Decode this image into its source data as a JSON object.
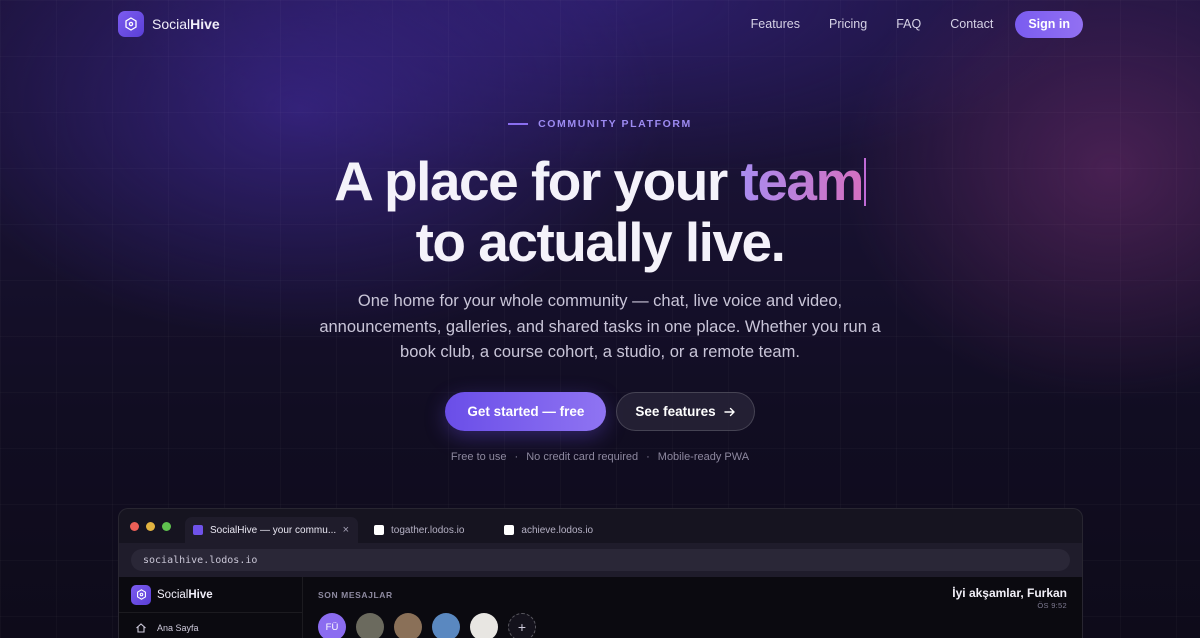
{
  "nav": {
    "brand_pre": "Social",
    "brand_bold": "Hive",
    "links": [
      "Features",
      "Pricing",
      "FAQ",
      "Contact"
    ],
    "signin": "Sign in",
    "logo_icon": "hive-logo-icon"
  },
  "hero": {
    "eyebrow": "COMMUNITY PLATFORM",
    "title_line1": "A place for your ",
    "title_highlight": "team",
    "title_line2": "to actually live.",
    "subtitle": "One home for your whole community — chat, live voice and video, announcements, galleries, and shared tasks in one place. Whether you run a book club, a course cohort, a studio, or a remote team.",
    "cta_primary": "Get started — free",
    "cta_secondary": "See features",
    "cta_secondary_icon": "arrow-right-icon",
    "perks": [
      "Free to use",
      "No credit card required",
      "Mobile-ready PWA"
    ],
    "perk_separator": "·"
  },
  "browser": {
    "tabs": [
      {
        "label": "SocialHive — your commu...",
        "close": "×",
        "active": true
      },
      {
        "label": "togather.lodos.io",
        "active": false
      },
      {
        "label": "achieve.lodos.io",
        "active": false
      }
    ],
    "url": "socialhive.lodos.io",
    "app": {
      "brand_pre": "Social",
      "brand_bold": "Hive",
      "sidebar_items": [
        {
          "label": "Ana Sayfa",
          "icon": "home-icon"
        }
      ],
      "section_title": "SON MESAJLAR",
      "greeting": "İyi akşamlar, Furkan",
      "time": "ÖS 9:52",
      "avatars": [
        {
          "initials": "FÜ",
          "color": "#8b6cf0"
        },
        {
          "initials": "",
          "color": "#6b6a5e"
        },
        {
          "initials": "",
          "color": "#8a7058"
        },
        {
          "initials": "",
          "color": "#5a88c0"
        },
        {
          "initials": "",
          "color": "#e8e6e2"
        }
      ],
      "add_label": "+"
    }
  },
  "colors": {
    "accent": "#7a5cf0",
    "highlight_start": "#a98cf0",
    "highlight_end": "#d46fc0",
    "dot_red": "#ec5f57",
    "dot_yellow": "#e2b340",
    "dot_green": "#5fc24e"
  }
}
